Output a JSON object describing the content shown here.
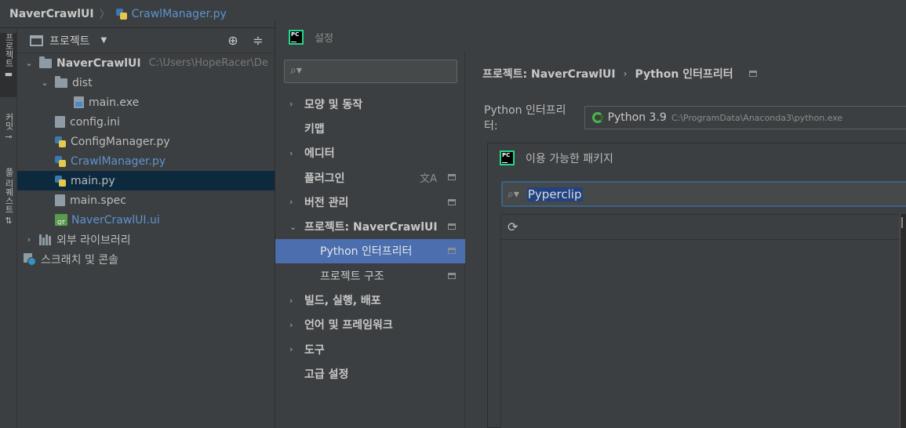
{
  "breadcrumb": {
    "project": "NaverCrawlUI",
    "file": "CrawlManager.py"
  },
  "tool_strip": {
    "tabs": [
      "프로젝트",
      "커밋",
      "풀 리퀘스트"
    ]
  },
  "project_panel": {
    "title": "프로젝트",
    "tree": [
      {
        "label": "NaverCrawlUI",
        "hint": "C:\\Users\\HopeRacer\\De",
        "type": "folder",
        "level": 0,
        "expanded": true
      },
      {
        "label": "dist",
        "type": "folder",
        "level": 1,
        "expanded": true
      },
      {
        "label": "main.exe",
        "type": "exe",
        "level": 2
      },
      {
        "label": "config.ini",
        "type": "file",
        "level": 1
      },
      {
        "label": "ConfigManager.py",
        "type": "py",
        "level": 1
      },
      {
        "label": "CrawlManager.py",
        "type": "py",
        "level": 1,
        "modified": true
      },
      {
        "label": "main.py",
        "type": "py",
        "level": 1,
        "selected": true
      },
      {
        "label": "main.spec",
        "type": "file",
        "level": 1
      },
      {
        "label": "NaverCrawlUI.ui",
        "type": "ui",
        "level": 1,
        "modified": true
      },
      {
        "label": "외부 라이브러리",
        "type": "lib",
        "level": 0,
        "expanded": false
      },
      {
        "label": "스크래치 및 콘솔",
        "type": "scratch",
        "level": 0
      }
    ]
  },
  "settings": {
    "title": "설정",
    "nav": [
      {
        "label": "모양 및 동작",
        "chevron": "right"
      },
      {
        "label": "키맵"
      },
      {
        "label": "에디터",
        "chevron": "right"
      },
      {
        "label": "플러그인",
        "translate": true,
        "scope": true
      },
      {
        "label": "버전 관리",
        "chevron": "right",
        "scope": true
      },
      {
        "label": "프로젝트: NaverCrawlUI",
        "chevron": "down",
        "scope": true
      },
      {
        "label": "Python 인터프리터",
        "sub": true,
        "selected": true,
        "scope": true
      },
      {
        "label": "프로젝트 구조",
        "sub": true,
        "scope": true
      },
      {
        "label": "빌드, 실행, 배포",
        "chevron": "right"
      },
      {
        "label": "언어 및 프레임워크",
        "chevron": "right"
      },
      {
        "label": "도구",
        "chevron": "right"
      },
      {
        "label": "고급 설정"
      }
    ],
    "crumb_parent": "프로젝트: NaverCrawlUI",
    "crumb_child": "Python 인터프리터",
    "interpreter_label": "Python 인터프리터:",
    "interpreter_name": "Python 3.9",
    "interpreter_path": "C:\\ProgramData\\Anaconda3\\python.exe"
  },
  "packages": {
    "title": "이용 가능한 패키지",
    "search_value": "Pyperclip"
  },
  "colors": {
    "accent": "#4b6eaf",
    "pycharm_green": "#21d789",
    "link_blue": "#5c93cf"
  }
}
